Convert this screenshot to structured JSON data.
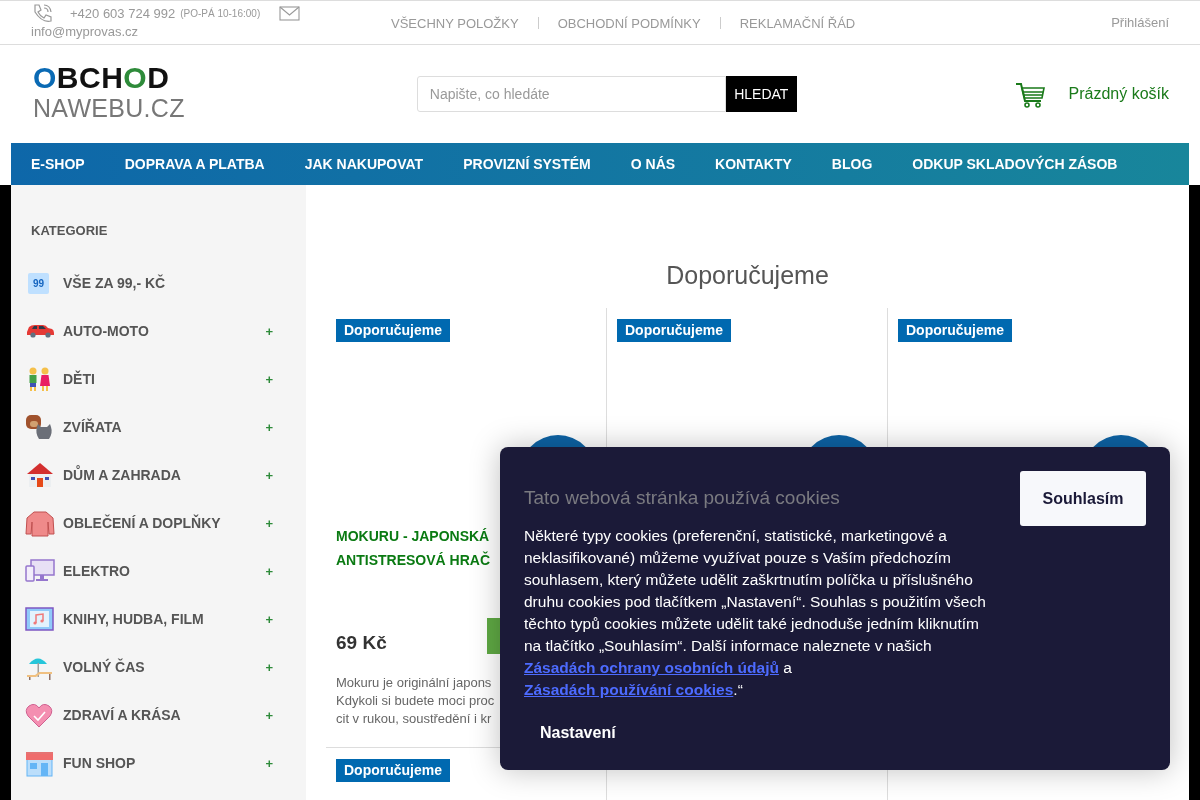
{
  "top_bar": {
    "phone": "+420 603 724 992",
    "hours": "(PO-PÁ 10-16:00)",
    "email": "info@myprovas.cz",
    "links": [
      "VŠECHNY POLOŽKY",
      "OBCHODNÍ PODMÍNKY",
      "REKLAMAČNÍ ŘÁD"
    ],
    "login": "Přihlášení"
  },
  "header": {
    "logo": {
      "line1": "OBCHOD",
      "line2": "NAWEBU.CZ"
    },
    "search": {
      "placeholder": "Napište, co hledáte",
      "button": "HLEDAT"
    },
    "cart": {
      "label": "Prázdný košík"
    }
  },
  "nav": {
    "items": [
      "E-SHOP",
      "DOPRAVA A PLATBA",
      "JAK NAKUPOVAT",
      "PROVIZNÍ SYSTÉM",
      "O NÁS",
      "KONTAKTY",
      "BLOG",
      "ODKUP SKLADOVÝCH ZÁSOB"
    ]
  },
  "sidebar": {
    "title": "KATEGORIE",
    "categories": [
      {
        "label": "VŠE ZA 99,- KČ",
        "badge": "99",
        "expandable": false
      },
      {
        "label": "AUTO-MOTO",
        "expandable": true
      },
      {
        "label": "DĚTI",
        "expandable": true
      },
      {
        "label": "ZVÍŘATA",
        "expandable": true
      },
      {
        "label": "DŮM A ZAHRADA",
        "expandable": true
      },
      {
        "label": "OBLEČENÍ A DOPLŇKY",
        "expandable": true
      },
      {
        "label": "ELEKTRO",
        "expandable": true
      },
      {
        "label": "KNIHY, HUDBA, FILM",
        "expandable": true
      },
      {
        "label": "VOLNÝ ČAS",
        "expandable": true
      },
      {
        "label": "ZDRAVÍ A KRÁSA",
        "expandable": true
      },
      {
        "label": "FUN SHOP",
        "expandable": true
      }
    ],
    "expand_sign": "+"
  },
  "content": {
    "heading": "Doporučujeme",
    "products": [
      {
        "badge": "Doporučujeme",
        "title": "MOKURU - JAPONSKÁ ANTISTRESOVÁ HRAČ",
        "price": "69 Kč",
        "description": "Mokuru je originální japons\nKdykoli si budete moci proc\ncit v rukou, soustředění i kr"
      },
      {
        "badge": "Doporučujeme"
      },
      {
        "badge": "Doporučujeme"
      },
      {
        "badge": "Doporučujeme"
      }
    ]
  },
  "cookie_dialog": {
    "title": "Tato webová stránka používá cookies",
    "text": [
      {
        "kind": "text",
        "text": "Některé typy cookies (preferenční, statistické, marketingové a neklasifikované) můžeme využívat pouze s Vaším předchozím souhlasem, který můžete udělit zaškrtnutím políčka u příslušného druhu cookies pod tlačítkem „Nastavení“. Souhlas s použitím všech těchto typů cookies můžete udělit také jednoduše jedním kliknutím na tlačítko „Souhlasím“. Další informace naleznete v našich "
      },
      {
        "kind": "link",
        "text": "Zásadách ochrany osobních údajů"
      },
      {
        "kind": "text",
        "text": " a "
      },
      {
        "kind": "link",
        "text": "Zásadách používání cookies"
      },
      {
        "kind": "text",
        "text": ".“"
      }
    ],
    "accept_button": "Souhlasím",
    "settings_button": "Nastavení"
  }
}
